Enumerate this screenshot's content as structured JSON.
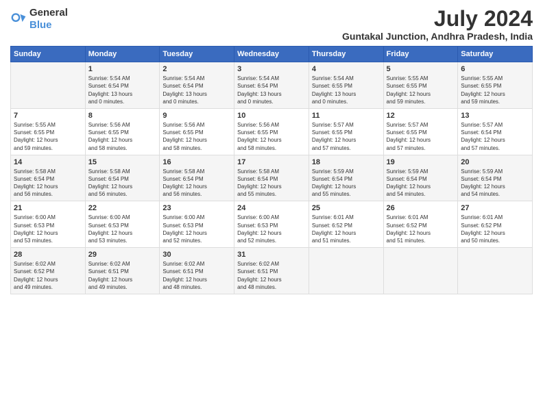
{
  "logo": {
    "text_general": "General",
    "text_blue": "Blue"
  },
  "header": {
    "month_year": "July 2024",
    "location": "Guntakal Junction, Andhra Pradesh, India"
  },
  "weekdays": [
    "Sunday",
    "Monday",
    "Tuesday",
    "Wednesday",
    "Thursday",
    "Friday",
    "Saturday"
  ],
  "weeks": [
    [
      {
        "day": "",
        "info": ""
      },
      {
        "day": "1",
        "info": "Sunrise: 5:54 AM\nSunset: 6:54 PM\nDaylight: 13 hours\nand 0 minutes."
      },
      {
        "day": "2",
        "info": "Sunrise: 5:54 AM\nSunset: 6:54 PM\nDaylight: 13 hours\nand 0 minutes."
      },
      {
        "day": "3",
        "info": "Sunrise: 5:54 AM\nSunset: 6:54 PM\nDaylight: 13 hours\nand 0 minutes."
      },
      {
        "day": "4",
        "info": "Sunrise: 5:54 AM\nSunset: 6:55 PM\nDaylight: 13 hours\nand 0 minutes."
      },
      {
        "day": "5",
        "info": "Sunrise: 5:55 AM\nSunset: 6:55 PM\nDaylight: 12 hours\nand 59 minutes."
      },
      {
        "day": "6",
        "info": "Sunrise: 5:55 AM\nSunset: 6:55 PM\nDaylight: 12 hours\nand 59 minutes."
      }
    ],
    [
      {
        "day": "7",
        "info": "Sunrise: 5:55 AM\nSunset: 6:55 PM\nDaylight: 12 hours\nand 59 minutes."
      },
      {
        "day": "8",
        "info": "Sunrise: 5:56 AM\nSunset: 6:55 PM\nDaylight: 12 hours\nand 58 minutes."
      },
      {
        "day": "9",
        "info": "Sunrise: 5:56 AM\nSunset: 6:55 PM\nDaylight: 12 hours\nand 58 minutes."
      },
      {
        "day": "10",
        "info": "Sunrise: 5:56 AM\nSunset: 6:55 PM\nDaylight: 12 hours\nand 58 minutes."
      },
      {
        "day": "11",
        "info": "Sunrise: 5:57 AM\nSunset: 6:55 PM\nDaylight: 12 hours\nand 57 minutes."
      },
      {
        "day": "12",
        "info": "Sunrise: 5:57 AM\nSunset: 6:55 PM\nDaylight: 12 hours\nand 57 minutes."
      },
      {
        "day": "13",
        "info": "Sunrise: 5:57 AM\nSunset: 6:54 PM\nDaylight: 12 hours\nand 57 minutes."
      }
    ],
    [
      {
        "day": "14",
        "info": "Sunrise: 5:58 AM\nSunset: 6:54 PM\nDaylight: 12 hours\nand 56 minutes."
      },
      {
        "day": "15",
        "info": "Sunrise: 5:58 AM\nSunset: 6:54 PM\nDaylight: 12 hours\nand 56 minutes."
      },
      {
        "day": "16",
        "info": "Sunrise: 5:58 AM\nSunset: 6:54 PM\nDaylight: 12 hours\nand 56 minutes."
      },
      {
        "day": "17",
        "info": "Sunrise: 5:58 AM\nSunset: 6:54 PM\nDaylight: 12 hours\nand 55 minutes."
      },
      {
        "day": "18",
        "info": "Sunrise: 5:59 AM\nSunset: 6:54 PM\nDaylight: 12 hours\nand 55 minutes."
      },
      {
        "day": "19",
        "info": "Sunrise: 5:59 AM\nSunset: 6:54 PM\nDaylight: 12 hours\nand 54 minutes."
      },
      {
        "day": "20",
        "info": "Sunrise: 5:59 AM\nSunset: 6:54 PM\nDaylight: 12 hours\nand 54 minutes."
      }
    ],
    [
      {
        "day": "21",
        "info": "Sunrise: 6:00 AM\nSunset: 6:53 PM\nDaylight: 12 hours\nand 53 minutes."
      },
      {
        "day": "22",
        "info": "Sunrise: 6:00 AM\nSunset: 6:53 PM\nDaylight: 12 hours\nand 53 minutes."
      },
      {
        "day": "23",
        "info": "Sunrise: 6:00 AM\nSunset: 6:53 PM\nDaylight: 12 hours\nand 52 minutes."
      },
      {
        "day": "24",
        "info": "Sunrise: 6:00 AM\nSunset: 6:53 PM\nDaylight: 12 hours\nand 52 minutes."
      },
      {
        "day": "25",
        "info": "Sunrise: 6:01 AM\nSunset: 6:52 PM\nDaylight: 12 hours\nand 51 minutes."
      },
      {
        "day": "26",
        "info": "Sunrise: 6:01 AM\nSunset: 6:52 PM\nDaylight: 12 hours\nand 51 minutes."
      },
      {
        "day": "27",
        "info": "Sunrise: 6:01 AM\nSunset: 6:52 PM\nDaylight: 12 hours\nand 50 minutes."
      }
    ],
    [
      {
        "day": "28",
        "info": "Sunrise: 6:02 AM\nSunset: 6:52 PM\nDaylight: 12 hours\nand 49 minutes."
      },
      {
        "day": "29",
        "info": "Sunrise: 6:02 AM\nSunset: 6:51 PM\nDaylight: 12 hours\nand 49 minutes."
      },
      {
        "day": "30",
        "info": "Sunrise: 6:02 AM\nSunset: 6:51 PM\nDaylight: 12 hours\nand 48 minutes."
      },
      {
        "day": "31",
        "info": "Sunrise: 6:02 AM\nSunset: 6:51 PM\nDaylight: 12 hours\nand 48 minutes."
      },
      {
        "day": "",
        "info": ""
      },
      {
        "day": "",
        "info": ""
      },
      {
        "day": "",
        "info": ""
      }
    ]
  ]
}
